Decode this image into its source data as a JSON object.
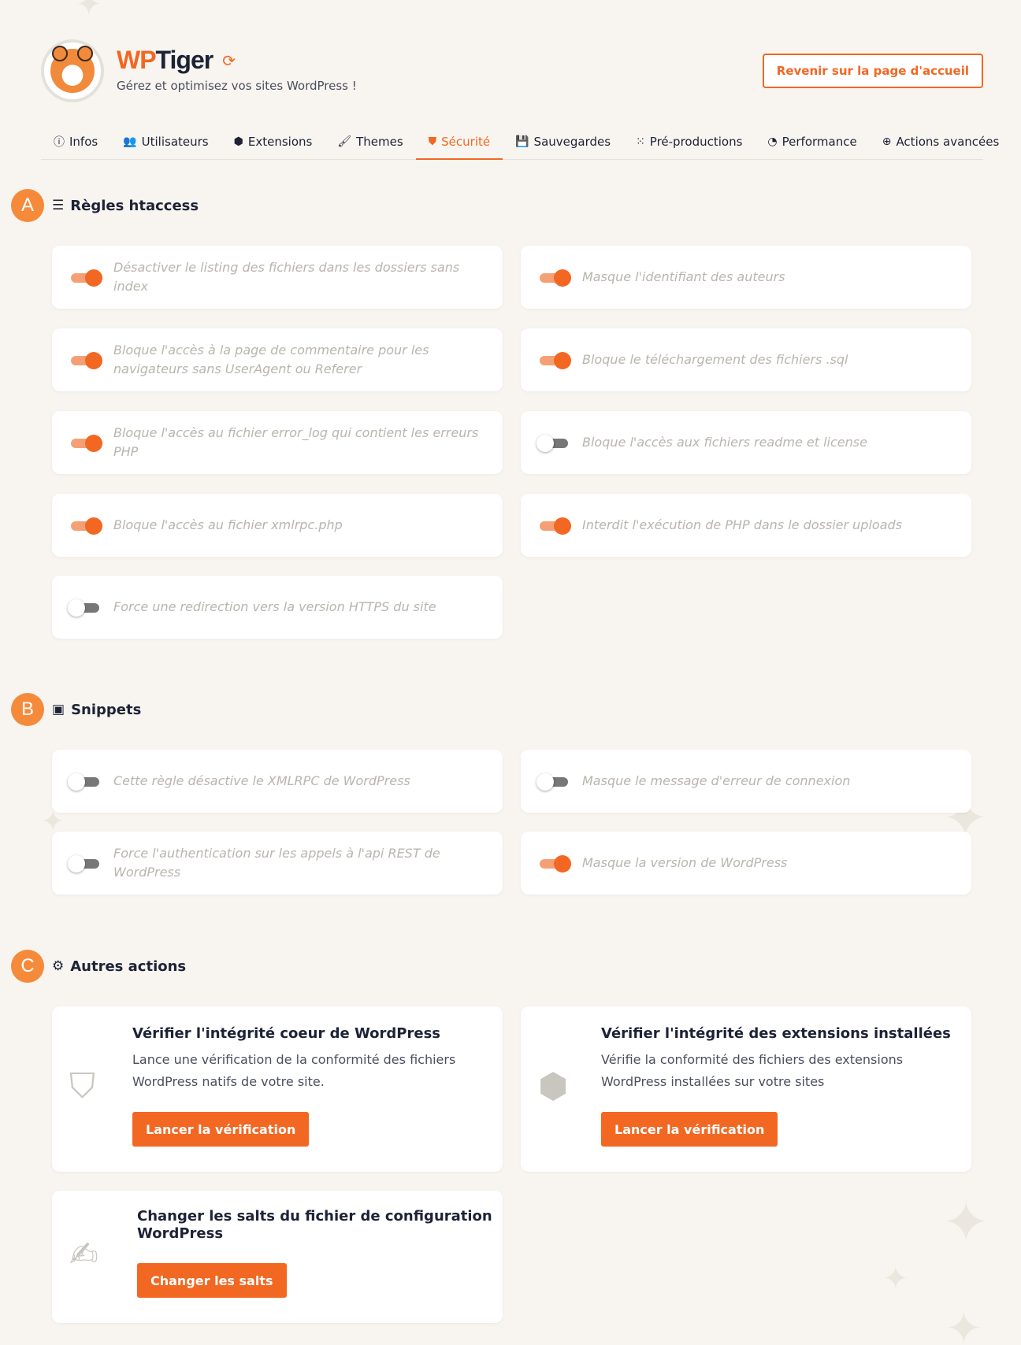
{
  "header": {
    "brand_wp": "WP",
    "brand_tiger": "Tiger",
    "tagline": "Gérez et optimisez vos sites WordPress !",
    "home_button": "Revenir sur la page d'accueil"
  },
  "tabs": [
    {
      "label": "Infos",
      "icon": "info-icon"
    },
    {
      "label": "Utilisateurs",
      "icon": "users-icon"
    },
    {
      "label": "Extensions",
      "icon": "cube-icon"
    },
    {
      "label": "Themes",
      "icon": "brush-icon"
    },
    {
      "label": "Sécurité",
      "icon": "shield-icon",
      "active": true
    },
    {
      "label": "Sauvegardes",
      "icon": "floppy-icon"
    },
    {
      "label": "Pré-productions",
      "icon": "spinner-icon"
    },
    {
      "label": "Performance",
      "icon": "gauge-icon"
    },
    {
      "label": "Actions avancées",
      "icon": "plus-circle-icon"
    }
  ],
  "sections": {
    "htaccess": {
      "badge": "A",
      "title": "Règles htaccess",
      "icon": "list-icon"
    },
    "snippets": {
      "badge": "B",
      "title": "Snippets",
      "icon": "inbox-icon"
    },
    "autres": {
      "badge": "C",
      "title": "Autres actions",
      "icon": "gear-icon"
    }
  },
  "htaccess_rules": [
    {
      "label": "Désactiver le listing des fichiers dans les dossiers sans index",
      "enabled": true
    },
    {
      "label": "Masque l'identifiant des auteurs",
      "enabled": true
    },
    {
      "label": "Bloque l'accès à la page de commentaire pour les navigateurs sans UserAgent ou Referer",
      "enabled": true
    },
    {
      "label": "Bloque le téléchargement des fichiers .sql",
      "enabled": true
    },
    {
      "label": "Bloque l'accès au fichier error_log qui contient les erreurs PHP",
      "enabled": true
    },
    {
      "label": "Bloque l'accès aux fichiers readme et license",
      "enabled": false
    },
    {
      "label": "Bloque l'accès au fichier xmlrpc.php",
      "enabled": true
    },
    {
      "label": "Interdit l'exécution de PHP dans le dossier uploads",
      "enabled": true
    },
    {
      "label": "Force une redirection vers la version HTTPS du site",
      "enabled": false
    }
  ],
  "snippets": [
    {
      "label": "Cette règle désactive le XMLRPC de WordPress",
      "enabled": false
    },
    {
      "label": "Masque le message d'erreur de connexion",
      "enabled": false
    },
    {
      "label": "Force l'authentication sur les appels à l'api REST de WordPress",
      "enabled": false
    },
    {
      "label": "Masque la version de WordPress",
      "enabled": true
    }
  ],
  "actions": [
    {
      "title": "Vérifier l'intégrité coeur de WordPress",
      "desc_line1": "Lance une vérification de la conformité des fichiers",
      "desc_line2": "WordPress natifs de votre site.",
      "button": "Lancer la vérification",
      "icon": "shield-heart-icon"
    },
    {
      "title": "Vérifier l'intégrité des extensions installées",
      "desc_line1": "Vérifie la conformité des fichiers des extensions",
      "desc_line2": "WordPress installées sur votre sites",
      "button": "Lancer la vérification",
      "icon": "box-icon"
    },
    {
      "title_line1": "Changer les salts du fichier de configuration",
      "title_line2": "WordPress",
      "button": "Changer les salts",
      "icon": "file-signature-icon"
    }
  ],
  "colors": {
    "accent": "#f26722",
    "badge": "#f58a3a",
    "background": "#f8f5f0"
  }
}
